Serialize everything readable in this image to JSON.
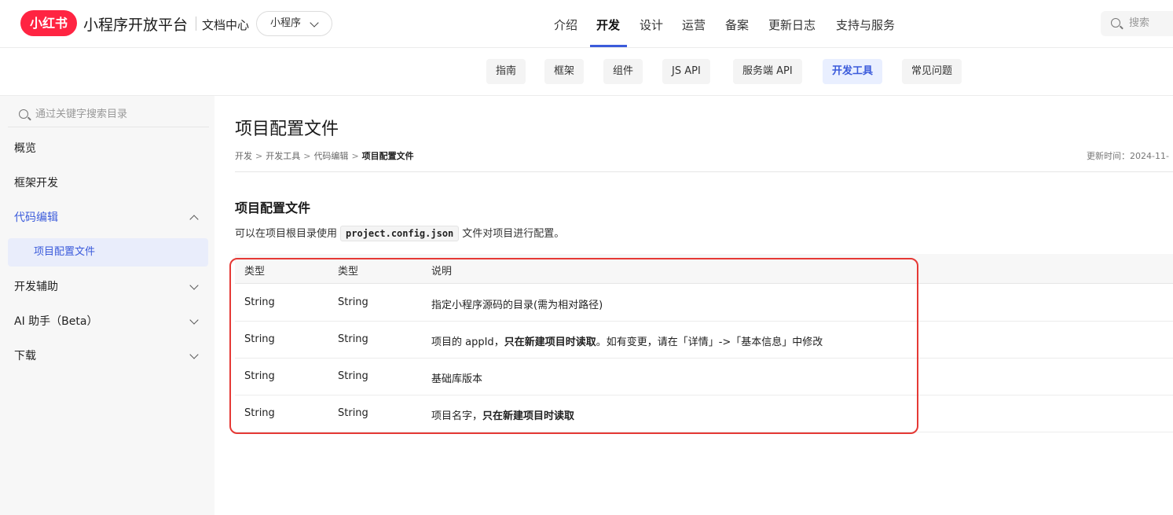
{
  "header": {
    "logo_text": "小红书",
    "brand": "小程序开放平台",
    "doc_center": "文档中心",
    "selector_value": "小程序",
    "nav": [
      {
        "label": "介绍"
      },
      {
        "label": "开发"
      },
      {
        "label": "设计"
      },
      {
        "label": "运营"
      },
      {
        "label": "备案"
      },
      {
        "label": "更新日志"
      },
      {
        "label": "支持与服务"
      }
    ],
    "active_nav": "开发",
    "search_placeholder": "搜索"
  },
  "subnav": {
    "tabs": [
      {
        "label": "指南"
      },
      {
        "label": "框架"
      },
      {
        "label": "组件"
      },
      {
        "label": "JS API"
      },
      {
        "label": "服务端 API"
      },
      {
        "label": "开发工具"
      },
      {
        "label": "常见问题"
      }
    ],
    "active": "开发工具"
  },
  "sidebar": {
    "search_placeholder": "通过关键字搜索目录",
    "items": [
      {
        "label": "概览"
      },
      {
        "label": "框架开发"
      },
      {
        "label": "代码编辑"
      },
      {
        "label": "项目配置文件"
      },
      {
        "label": "开发辅助"
      },
      {
        "label": "AI 助手（Beta）"
      },
      {
        "label": "下载"
      }
    ]
  },
  "main": {
    "title": "项目配置文件",
    "breadcrumb": [
      "开发",
      "开发工具",
      "代码编辑",
      "项目配置文件"
    ],
    "breadcrumb_sep": ">",
    "updated": "更新时间：2024-11-",
    "section_title": "项目配置文件",
    "desc_prefix": "可以在项目根目录使用",
    "desc_code": "project.config.json",
    "desc_suffix": "文件对项目进行配置。",
    "table": {
      "headers": [
        "类型",
        "类型",
        "说明"
      ],
      "rows": [
        {
          "c1": "String",
          "c2": "String",
          "desc": "指定小程序源码的目录(需为相对路径)",
          "bold": "",
          "tail": ""
        },
        {
          "c1": "String",
          "c2": "String",
          "desc": "项目的 appId，",
          "bold": "只在新建项目时读取",
          "tail": "。如有变更，请在「详情」->「基本信息」中修改"
        },
        {
          "c1": "String",
          "c2": "String",
          "desc": "基础库版本",
          "bold": "",
          "tail": ""
        },
        {
          "c1": "String",
          "c2": "String",
          "desc": "项目名字，",
          "bold": "只在新建项目时读取",
          "tail": ""
        }
      ]
    }
  },
  "colors": {
    "accent": "#3b5bdb",
    "brand": "#ff2442",
    "highlight": "#e53935"
  }
}
